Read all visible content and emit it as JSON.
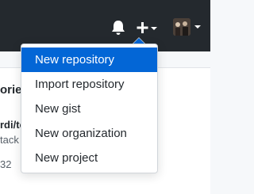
{
  "header": {
    "background": "#24292e",
    "icons": [
      "bell-icon",
      "plus-icon",
      "chevron-down-icon",
      "avatar"
    ]
  },
  "background_page": {
    "heading_fragment": "orie",
    "repo_fragment": "rdi/to",
    "sub_fragment": "tack",
    "num_fragment": "32"
  },
  "dropdown": {
    "active_color": "#0366d6",
    "items": [
      {
        "label": "New repository",
        "active": true
      },
      {
        "label": "Import repository",
        "active": false
      },
      {
        "label": "New gist",
        "active": false
      },
      {
        "label": "New organization",
        "active": false
      },
      {
        "label": "New project",
        "active": false
      }
    ]
  }
}
